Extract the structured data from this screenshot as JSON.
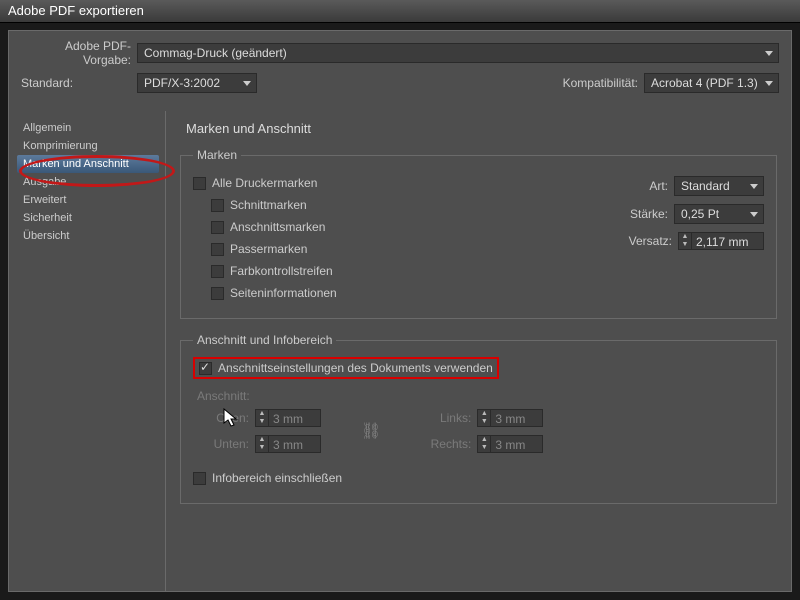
{
  "window": {
    "title": "Adobe PDF exportieren"
  },
  "labels": {
    "pdf_vorgabe": "Adobe PDF-Vorgabe:",
    "standard": "Standard:",
    "kompat": "Kompatibilität:"
  },
  "dropdowns": {
    "pdf_vorgabe": "Commag-Druck (geändert)",
    "standard": "PDF/X-3:2002",
    "kompat": "Acrobat 4 (PDF 1.3)"
  },
  "sidebar": {
    "items": [
      {
        "label": "Allgemein"
      },
      {
        "label": "Komprimierung"
      },
      {
        "label": "Marken und Anschnitt"
      },
      {
        "label": "Ausgabe"
      },
      {
        "label": "Erweitert"
      },
      {
        "label": "Sicherheit"
      },
      {
        "label": "Übersicht"
      }
    ],
    "selected_index": 2
  },
  "main": {
    "title": "Marken und Anschnitt",
    "marks": {
      "legend": "Marken",
      "all": "Alle Druckermarken",
      "cut": "Schnittmarken",
      "bleed": "Anschnittsmarken",
      "reg": "Passermarken",
      "color": "Farbkontrollstreifen",
      "page": "Seiteninformationen",
      "art_label": "Art:",
      "art_value": "Standard",
      "weight_label": "Stärke:",
      "weight_value": "0,25 Pt",
      "offset_label": "Versatz:",
      "offset_value": "2,117 mm"
    },
    "bleed": {
      "legend": "Anschnitt und Infobereich",
      "use_doc": "Anschnittseinstellungen des Dokuments verwenden",
      "title": "Anschnitt:",
      "top": "Oben:",
      "bottom": "Unten:",
      "left": "Links:",
      "right": "Rechts:",
      "val": "3 mm",
      "info": "Infobereich einschließen"
    }
  }
}
